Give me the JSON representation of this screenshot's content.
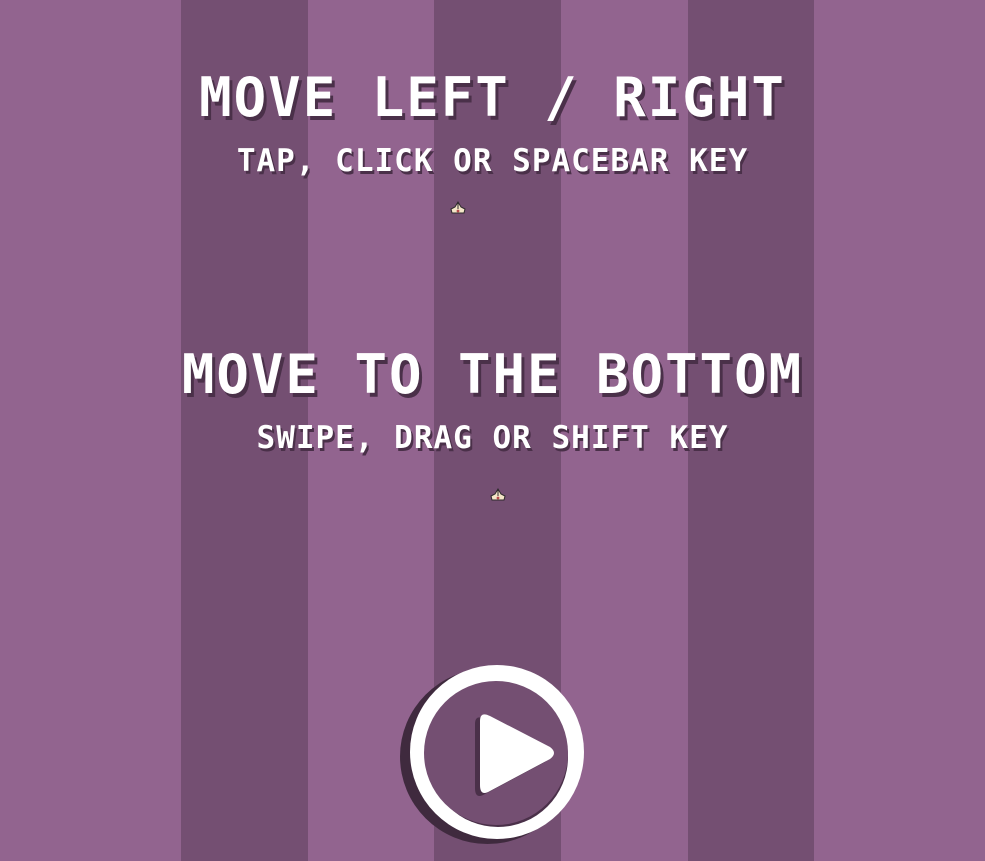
{
  "instructions": {
    "horizontal": {
      "title": "Move Left / Right",
      "subtitle": "Tap, Click or Spacebar key"
    },
    "vertical": {
      "title": "Move to the Bottom",
      "subtitle": "Swipe, Drag or Shift key"
    }
  },
  "icons": {
    "hand_icon": "hand-pointer-icon",
    "play_icon": "play-icon"
  },
  "colors": {
    "background_light": "#92648f",
    "background_dark": "#744f72",
    "text": "#ffffff",
    "shadow": "#4a3049"
  }
}
